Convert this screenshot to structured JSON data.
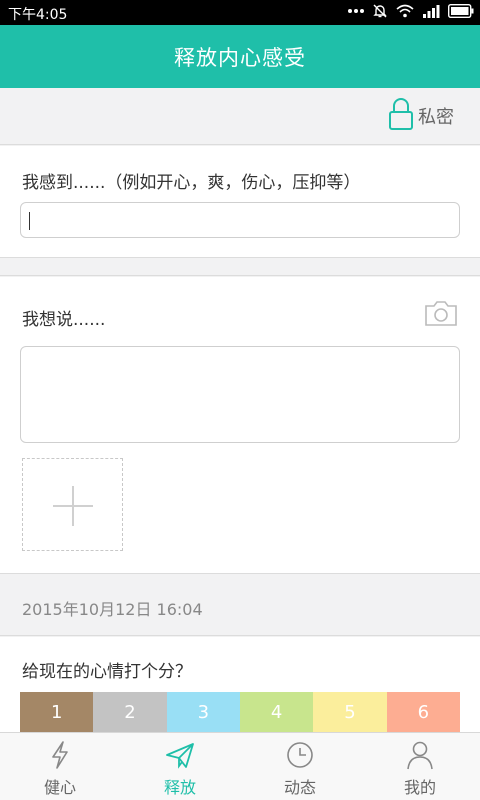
{
  "status_bar": {
    "time": "下午4:05",
    "icons": [
      "more-dots-icon",
      "mute-bell-icon",
      "wifi-icon",
      "signal-icon",
      "battery-icon"
    ]
  },
  "header": {
    "title": "释放内心感受"
  },
  "privacy": {
    "label": "私密",
    "icon": "lock-icon"
  },
  "feel": {
    "label": "我感到......（例如开心，爽，伤心，压抑等）",
    "value": ""
  },
  "say": {
    "label": "我想说......",
    "value": "",
    "icon": "camera-icon"
  },
  "add_photo": {
    "icon": "plus-icon"
  },
  "datetime": "2015年10月12日 16:04",
  "score": {
    "label": "给现在的心情打个分？",
    "options": [
      {
        "value": "1",
        "color": "#a48766"
      },
      {
        "value": "2",
        "color": "#c3c3c3"
      },
      {
        "value": "3",
        "color": "#99dff5"
      },
      {
        "value": "4",
        "color": "#c8e58d"
      },
      {
        "value": "5",
        "color": "#fbee9c"
      },
      {
        "value": "6",
        "color": "#fdad92"
      }
    ]
  },
  "tabs": [
    {
      "label": "健心",
      "icon": "lightning-icon",
      "active": false
    },
    {
      "label": "释放",
      "icon": "paper-plane-icon",
      "active": true
    },
    {
      "label": "动态",
      "icon": "clock-icon",
      "active": false
    },
    {
      "label": "我的",
      "icon": "person-icon",
      "active": false
    }
  ],
  "colors": {
    "accent": "#1fbfa9"
  }
}
